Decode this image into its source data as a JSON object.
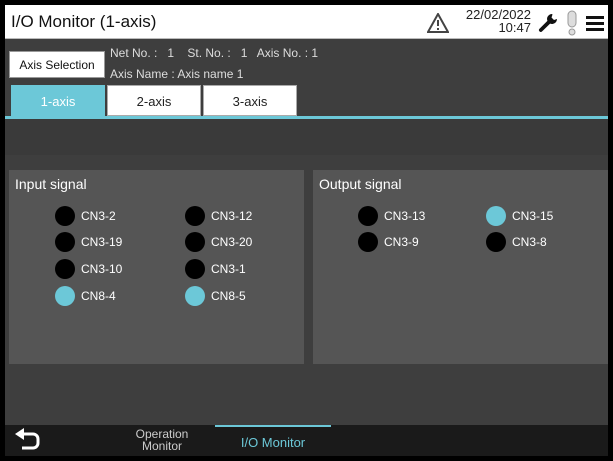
{
  "header": {
    "title": "I/O Monitor (1-axis)",
    "date": "22/02/2022",
    "time": "10:47"
  },
  "axis_info": {
    "axis_selection_label": "Axis Selection",
    "line1": "Net No. :   1    St. No. :   1   Axis No. : 1",
    "line2": "Axis Name : Axis name 1"
  },
  "tabs": [
    {
      "label": "1-axis",
      "active": true
    },
    {
      "label": "2-axis",
      "active": false
    },
    {
      "label": "3-axis",
      "active": false
    }
  ],
  "input_signal": {
    "title": "Input signal",
    "signals": [
      {
        "label": "CN3-2",
        "on": false
      },
      {
        "label": "CN3-12",
        "on": false
      },
      {
        "label": "CN3-19",
        "on": false
      },
      {
        "label": "CN3-20",
        "on": false
      },
      {
        "label": "CN3-10",
        "on": false
      },
      {
        "label": "CN3-1",
        "on": false
      },
      {
        "label": "CN8-4",
        "on": true
      },
      {
        "label": "CN8-5",
        "on": true
      }
    ]
  },
  "output_signal": {
    "title": "Output signal",
    "signals": [
      {
        "label": "CN3-13",
        "on": false
      },
      {
        "label": "CN3-15",
        "on": true
      },
      {
        "label": "CN3-9",
        "on": false
      },
      {
        "label": "CN3-8",
        "on": false
      }
    ]
  },
  "bottom_nav": {
    "operation_monitor_line1": "Operation",
    "operation_monitor_line2": "Monitor",
    "io_monitor": "I/O Monitor"
  },
  "colors": {
    "accent": "#6cc8d8",
    "background": "#3e3e3e",
    "panel": "#555555",
    "led_off": "#000000"
  },
  "icons": [
    "warning-icon",
    "wrench-icon",
    "alarm-icon",
    "menu-icon",
    "back-icon"
  ]
}
